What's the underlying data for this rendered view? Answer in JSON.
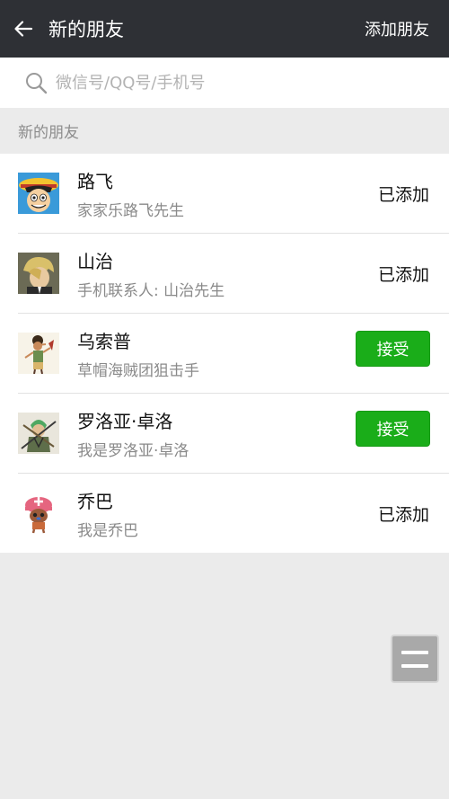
{
  "header": {
    "title": "新的朋友",
    "action_label": "添加朋友",
    "back_icon": "arrow-left-icon"
  },
  "search": {
    "placeholder": "微信号/QQ号/手机号",
    "icon": "search-icon"
  },
  "section": {
    "title": "新的朋友"
  },
  "friends": [
    {
      "name": "路飞",
      "message": "家家乐路飞先生",
      "status": "已添加",
      "state": "added",
      "avatar": "luffy-avatar"
    },
    {
      "name": "山治",
      "message": "手机联系人: 山治先生",
      "status": "已添加",
      "state": "added",
      "avatar": "sanji-avatar"
    },
    {
      "name": "乌索普",
      "message": "草帽海贼团狙击手",
      "status": "接受",
      "state": "pending",
      "avatar": "usopp-avatar"
    },
    {
      "name": "罗洛亚·卓洛",
      "message": "我是罗洛亚·卓洛",
      "status": "接受",
      "state": "pending",
      "avatar": "zoro-avatar"
    },
    {
      "name": "乔巴",
      "message": "我是乔巴",
      "status": "已添加",
      "state": "added",
      "avatar": "chopper-avatar"
    }
  ],
  "floating_button": {
    "icon": "menu-icon"
  },
  "colors": {
    "header_bg": "#2e3035",
    "accept_green": "#1aad19",
    "page_bg": "#ebebeb"
  }
}
